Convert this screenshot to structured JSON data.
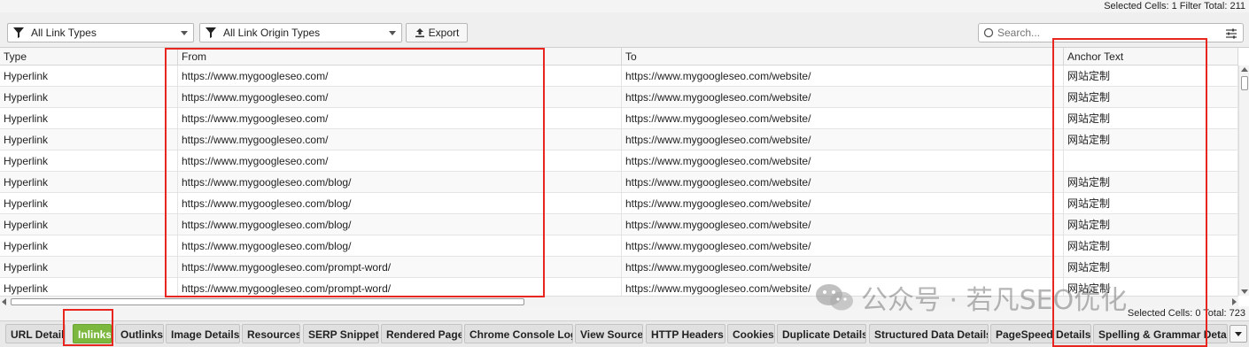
{
  "status_top": "Selected Cells:  1  Filter Total:  211",
  "toolbar": {
    "link_types": "All Link Types",
    "origin_types": "All Link Origin Types",
    "export_label": "Export",
    "search_placeholder": "Search..."
  },
  "table": {
    "headers": [
      "Type",
      "From",
      "To",
      "Anchor Text"
    ],
    "rows": [
      [
        "Hyperlink",
        "https://www.mygoogleseo.com/",
        "https://www.mygoogleseo.com/website/",
        "网站定制"
      ],
      [
        "Hyperlink",
        "https://www.mygoogleseo.com/",
        "https://www.mygoogleseo.com/website/",
        "网站定制"
      ],
      [
        "Hyperlink",
        "https://www.mygoogleseo.com/",
        "https://www.mygoogleseo.com/website/",
        "网站定制"
      ],
      [
        "Hyperlink",
        "https://www.mygoogleseo.com/",
        "https://www.mygoogleseo.com/website/",
        "网站定制"
      ],
      [
        "Hyperlink",
        "https://www.mygoogleseo.com/",
        "https://www.mygoogleseo.com/website/",
        ""
      ],
      [
        "Hyperlink",
        "https://www.mygoogleseo.com/blog/",
        "https://www.mygoogleseo.com/website/",
        "网站定制"
      ],
      [
        "Hyperlink",
        "https://www.mygoogleseo.com/blog/",
        "https://www.mygoogleseo.com/website/",
        "网站定制"
      ],
      [
        "Hyperlink",
        "https://www.mygoogleseo.com/blog/",
        "https://www.mygoogleseo.com/website/",
        "网站定制"
      ],
      [
        "Hyperlink",
        "https://www.mygoogleseo.com/blog/",
        "https://www.mygoogleseo.com/website/",
        "网站定制"
      ],
      [
        "Hyperlink",
        "https://www.mygoogleseo.com/prompt-word/",
        "https://www.mygoogleseo.com/website/",
        "网站定制"
      ],
      [
        "Hyperlink",
        "https://www.mygoogleseo.com/prompt-word/",
        "https://www.mygoogleseo.com/website/",
        "网站定制"
      ]
    ]
  },
  "status_bottom": "Selected Cells:  0  Total:  723",
  "tabs": [
    "URL Details",
    "Inlinks",
    "Outlinks",
    "Image Details",
    "Resources",
    "SERP Snippet",
    "Rendered Page",
    "Chrome Console Log",
    "View Source",
    "HTTP Headers",
    "Cookies",
    "Duplicate Details",
    "Structured Data Details",
    "PageSpeed Details",
    "Spelling & Grammar Details"
  ],
  "active_tab": "Inlinks",
  "watermark": "公众号 · 若凡SEO优化",
  "colors": {
    "highlight": "#e8251f",
    "active_tab": "#7cb83e"
  }
}
